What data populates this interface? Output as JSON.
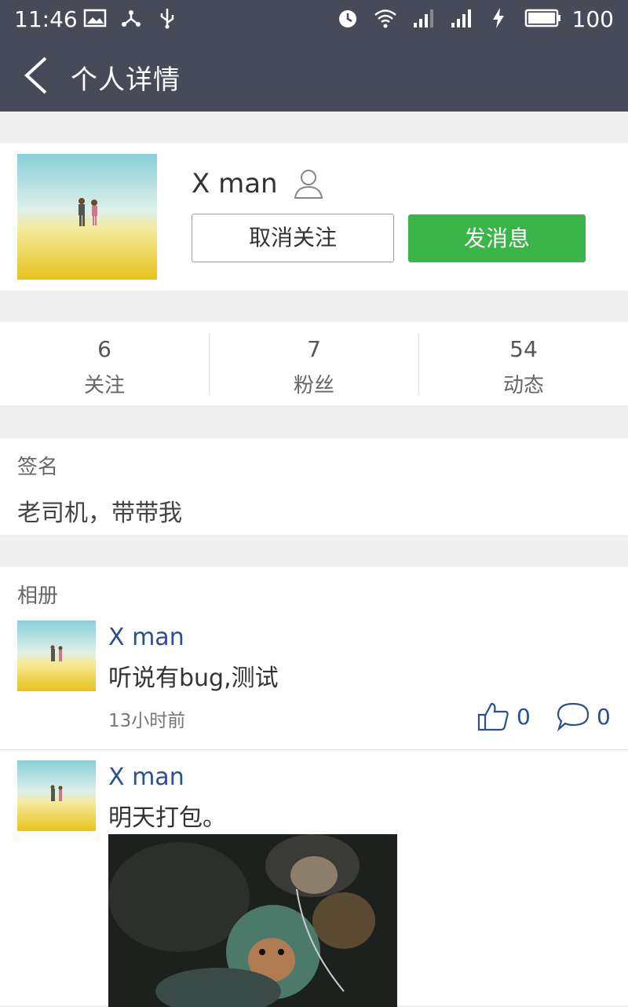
{
  "status_bar": {
    "time": "11:46",
    "battery_level": "100",
    "icons": [
      "image-icon",
      "share-icon",
      "usb-icon",
      "alarm-icon",
      "wifi-icon",
      "signal-icon",
      "signal-3g-icon",
      "charging-icon",
      "battery-icon"
    ]
  },
  "header": {
    "title": "个人详情",
    "back_icon": "chevron-left-icon"
  },
  "profile": {
    "name": "X man",
    "unfollow_label": "取消关注",
    "message_label": "发消息",
    "accent_color": "#3bb44a"
  },
  "stats": [
    {
      "value": "6",
      "label": "关注"
    },
    {
      "value": "7",
      "label": "粉丝"
    },
    {
      "value": "54",
      "label": "动态"
    }
  ],
  "signature": {
    "label": "签名",
    "text": "老司机，带带我"
  },
  "album": {
    "label": "相册",
    "posts": [
      {
        "author": "X man",
        "text": "听说有bug,测试",
        "time": "13小时前",
        "likes": "0",
        "comments": "0"
      },
      {
        "author": "X man",
        "text": "明天打包。"
      }
    ]
  }
}
